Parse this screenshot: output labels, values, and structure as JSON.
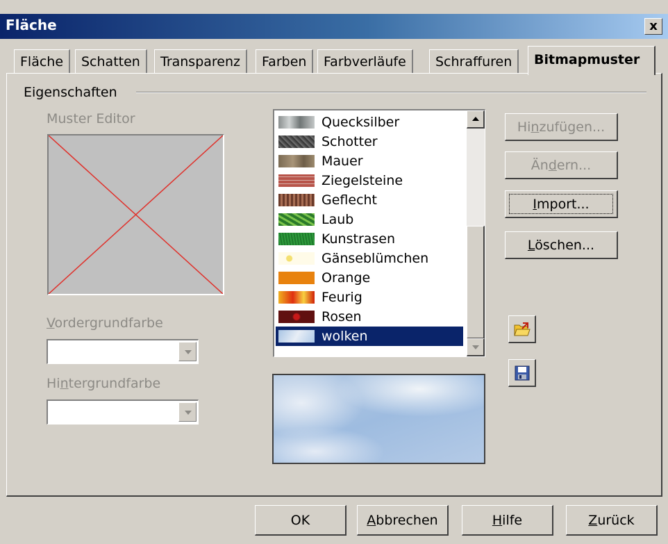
{
  "window": {
    "title": "Fläche",
    "close_label": "x"
  },
  "tabs": [
    {
      "label": "Fläche"
    },
    {
      "label": "Schatten"
    },
    {
      "label": "Transparenz"
    },
    {
      "label": "Farben"
    },
    {
      "label": "Farbverläufe"
    },
    {
      "label": "Schraffuren"
    },
    {
      "label": "Bitmapmuster",
      "active": true
    }
  ],
  "properties": {
    "group_label": "Eigenschaften",
    "muster_editor_label": "Muster Editor",
    "foreground": {
      "pre": "",
      "key": "V",
      "post": "ordergrundfarbe",
      "value": ""
    },
    "background": {
      "pre": "Hi",
      "key": "n",
      "post": "tergrundfarbe",
      "value": ""
    }
  },
  "bitmap_list": {
    "items": [
      {
        "label": "Quecksilber"
      },
      {
        "label": "Schotter"
      },
      {
        "label": "Mauer"
      },
      {
        "label": "Ziegelsteine"
      },
      {
        "label": "Geflecht"
      },
      {
        "label": "Laub"
      },
      {
        "label": "Kunstrasen"
      },
      {
        "label": "Gänseblümchen"
      },
      {
        "label": "Orange"
      },
      {
        "label": "Feurig"
      },
      {
        "label": "Rosen"
      },
      {
        "label": "wolken",
        "selected": true
      }
    ],
    "selected": "wolken"
  },
  "actions": {
    "add": {
      "pre": "Hi",
      "key": "n",
      "post": "zufügen..."
    },
    "modify": {
      "pre": "Än",
      "key": "d",
      "post": "ern..."
    },
    "import": {
      "pre": "",
      "key": "I",
      "post": "mport..."
    },
    "delete": {
      "pre": "",
      "key": "L",
      "post": "öschen..."
    }
  },
  "footer": {
    "ok": {
      "pre": "OK",
      "key": "",
      "post": ""
    },
    "cancel": {
      "pre": "",
      "key": "A",
      "post": "bbrechen"
    },
    "help": {
      "pre": "",
      "key": "H",
      "post": "ilfe"
    },
    "reset": {
      "pre": "",
      "key": "Z",
      "post": "urück"
    }
  }
}
